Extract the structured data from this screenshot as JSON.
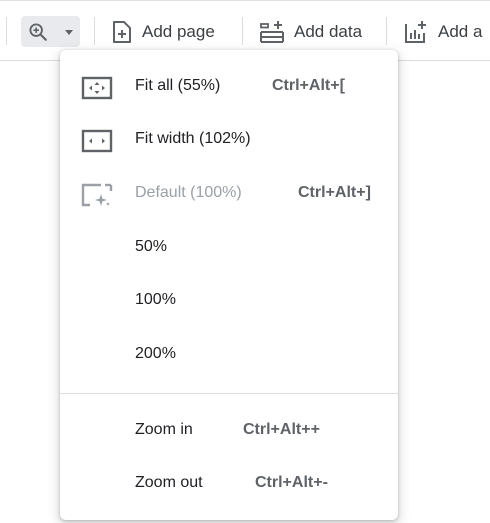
{
  "toolbar": {
    "zoom_icon": "zoom-in-icon",
    "add_page_label": "Add page",
    "add_data_label": "Add data",
    "add_chart_label": "Add a"
  },
  "zoom_menu": {
    "items": [
      {
        "label": "Fit all (55%)",
        "shortcut": "Ctrl+Alt+[",
        "icon": "fit-all-icon",
        "disabled": false
      },
      {
        "label": "Fit width (102%)",
        "shortcut": "",
        "icon": "fit-width-icon",
        "disabled": false
      },
      {
        "label": "Default (100%)",
        "shortcut": "Ctrl+Alt+]",
        "icon": "default-zoom-icon",
        "disabled": true
      },
      {
        "label": "50%",
        "shortcut": ""
      },
      {
        "label": "100%",
        "shortcut": ""
      },
      {
        "label": "200%",
        "shortcut": ""
      },
      {
        "label": "Zoom in",
        "shortcut": "Ctrl+Alt++"
      },
      {
        "label": "Zoom out",
        "shortcut": "Ctrl+Alt+-"
      }
    ]
  },
  "colors": {
    "icon": "#5f6368",
    "disabled_text": "#9aa0a6",
    "zoom_button_bg": "#e8eaed",
    "divider": "#dadce0"
  }
}
